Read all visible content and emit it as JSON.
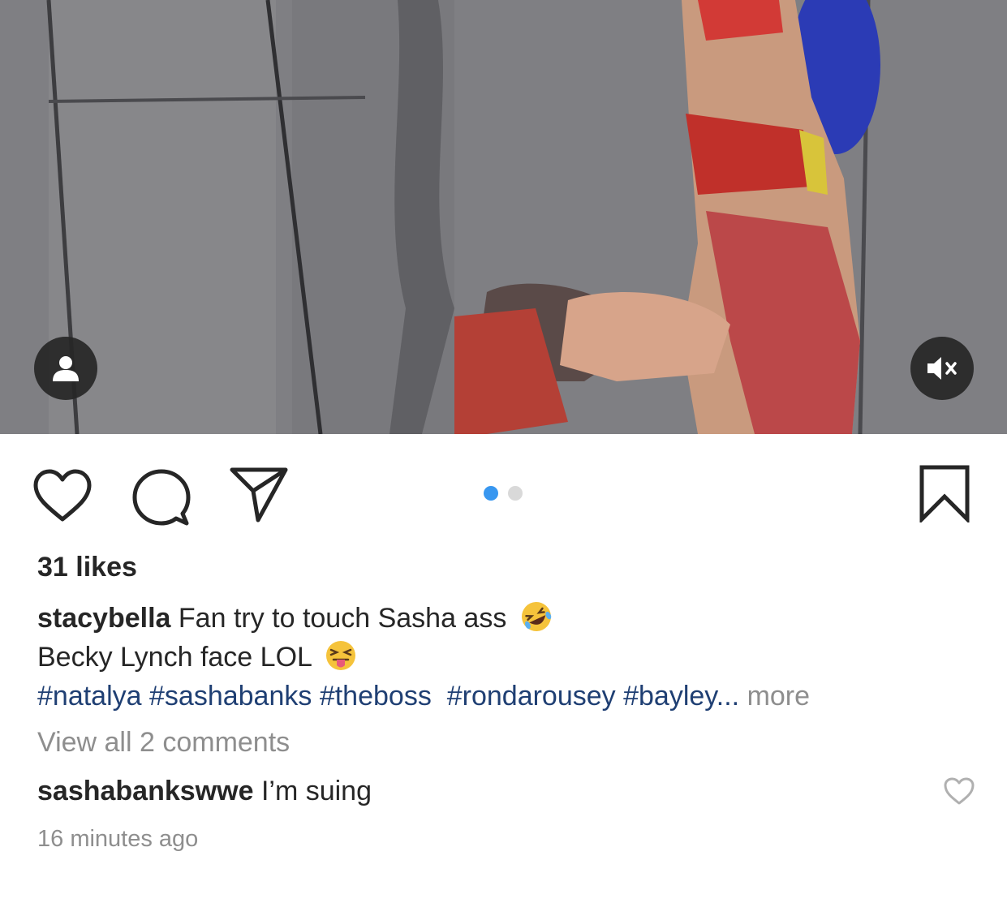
{
  "post": {
    "likes_text": "31 likes",
    "caption": {
      "username": "stacybella",
      "line1": "Fan try to touch Sasha ass",
      "line1_emoji": "rolling-on-floor-laughing-emoji",
      "line2": "Becky Lynch face LOL",
      "line2_emoji": "squinting-face-with-tongue-emoji",
      "hashtags": [
        "#natalya",
        "#sashabanks",
        "#theboss",
        "#rondarousey",
        "#bayley"
      ],
      "ellipsis": "...",
      "more_label": "more"
    },
    "view_all_comments": "View all 2 comments",
    "comment": {
      "username": "sashabankswwe",
      "text": "I’m suing"
    },
    "timestamp": "16 minutes ago"
  },
  "carousel": {
    "total": 2,
    "active_index": 0
  },
  "icons": {
    "tagged_users": "user-icon",
    "mute": "speaker-muted-icon",
    "like": "heart-icon",
    "comment": "comment-bubble-icon",
    "share": "paper-plane-icon",
    "save": "bookmark-icon",
    "comment_like": "heart-icon"
  },
  "colors": {
    "text": "#262626",
    "secondary": "#8e8e8e",
    "hashtag": "#1f3f73",
    "carousel_active": "#3897f0",
    "carousel_inactive": "#d9d9d9",
    "overlay": "#262626"
  }
}
